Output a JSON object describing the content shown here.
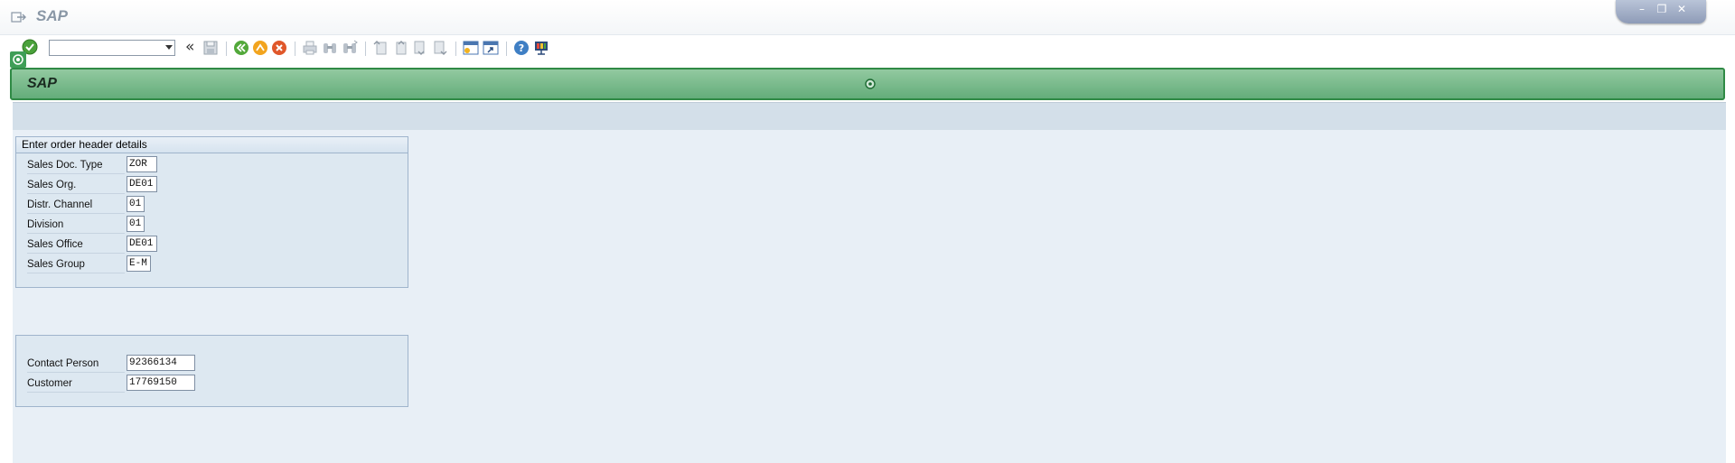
{
  "window": {
    "title": "SAP",
    "controls": [
      "minimize-icon",
      "restore-icon",
      "close-icon"
    ]
  },
  "toolbar": {
    "command_field_value": "",
    "icons": [
      "enter-icon",
      "save-icon",
      "back-icon",
      "exit-icon",
      "cancel-icon",
      "print-icon",
      "find-icon",
      "find-next-icon",
      "first-page-icon",
      "previous-page-icon",
      "next-page-icon",
      "last-page-icon",
      "create-session-icon",
      "shortcut-icon",
      "help-icon",
      "customize-layout-icon"
    ]
  },
  "header": {
    "title": "SAP"
  },
  "order_header_group": {
    "title": "Enter order header details",
    "fields": [
      {
        "label": "Sales Doc. Type",
        "value": "ZOR"
      },
      {
        "label": "Sales Org.",
        "value": "DE01"
      },
      {
        "label": "Distr. Channel",
        "value": "01"
      },
      {
        "label": "Division",
        "value": "01"
      },
      {
        "label": "Sales Office",
        "value": "DE01"
      },
      {
        "label": "Sales Group",
        "value": "E-M"
      }
    ]
  },
  "partner_group": {
    "fields": [
      {
        "label": "Contact Person",
        "value": "92366134"
      },
      {
        "label": "Customer",
        "value": "17769150"
      }
    ]
  },
  "colors": {
    "header_green": "#64ad7a",
    "header_border": "#2f8a45",
    "content_bg": "#e8eff6",
    "group_bg": "#dde8f1"
  }
}
